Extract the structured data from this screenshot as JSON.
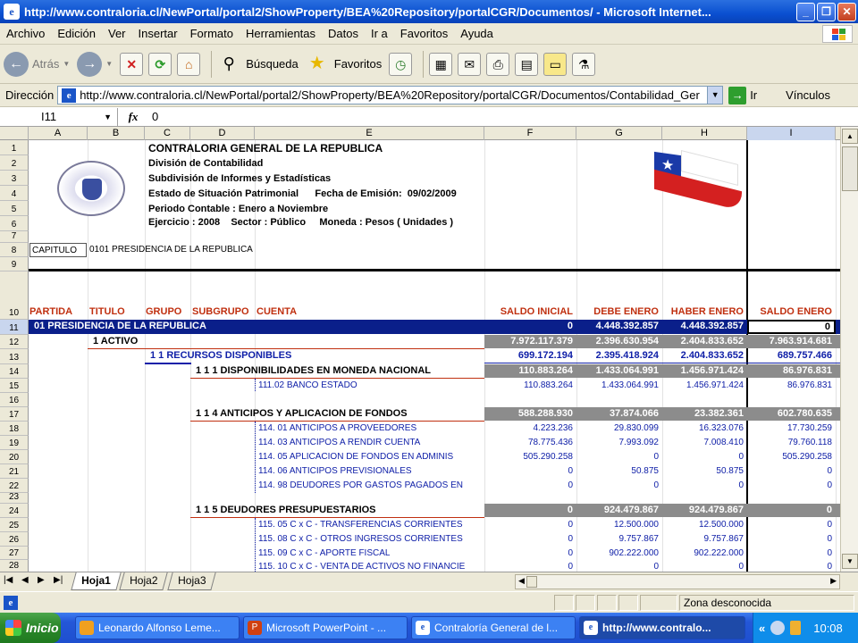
{
  "window": {
    "title": "http://www.contraloria.cl/NewPortal/portal2/ShowProperty/BEA%20Repository/portalCGR/Documentos/ - Microsoft Internet..."
  },
  "menu": [
    "Archivo",
    "Edición",
    "Ver",
    "Insertar",
    "Formato",
    "Herramientas",
    "Datos",
    "Ir a",
    "Favoritos",
    "Ayuda"
  ],
  "toolbar": {
    "back": "Atrás",
    "search": "Búsqueda",
    "favorites": "Favoritos"
  },
  "address": {
    "label": "Dirección",
    "url": "http://www.contraloria.cl/NewPortal/portal2/ShowProperty/BEA%20Repository/portalCGR/Documentos/Contabilidad_Ger",
    "go": "Ir",
    "links": "Vínculos"
  },
  "formula": {
    "cell": "I11",
    "fx": "fx",
    "value": "0"
  },
  "columns": [
    "A",
    "B",
    "C",
    "D",
    "E",
    "F",
    "G",
    "H",
    "I"
  ],
  "rows": [
    "1",
    "2",
    "3",
    "4",
    "5",
    "6",
    "7",
    "8",
    "9",
    "10",
    "11",
    "12",
    "13",
    "14",
    "15",
    "16",
    "17",
    "18",
    "19",
    "20",
    "21",
    "22",
    "23",
    "24",
    "25",
    "26",
    "27",
    "28"
  ],
  "header": {
    "line1": "CONTRALORIA GENERAL DE LA REPUBLICA",
    "line2": "División de Contabilidad",
    "line3": "Subdivisión de Informes y Estadísticas",
    "line4": "Estado de Situación Patrimonial      Fecha de Emisión:  09/02/2009",
    "line5": "Periodo Contable : Enero a Noviembre",
    "line6": "Ejercicio : 2008    Sector : Público     Moneda : Pesos ( Unidades )"
  },
  "capitulo": {
    "label": "CAPITULO",
    "value": "0101 PRESIDENCIA DE LA REPUBLICA"
  },
  "col_headers": {
    "partida": "PARTIDA",
    "titulo": "TITULO",
    "grupo": "GRUPO",
    "subgrupo": "SUBGRUPO",
    "cuenta": "CUENTA",
    "saldo_inicial": "SALDO INICIAL",
    "debe": "DEBE ENERO",
    "haber": "HABER ENERO",
    "saldo": "SALDO ENERO"
  },
  "table": {
    "r11": {
      "label": "01 PRESIDENCIA DE LA REPUBLICA",
      "f": "0",
      "g": "4.448.392.857",
      "h": "4.448.392.857",
      "i": "0"
    },
    "r12": {
      "label": "1 ACTIVO",
      "f": "7.972.117.379",
      "g": "2.396.630.954",
      "h": "2.404.833.652",
      "i": "7.963.914.681"
    },
    "r13": {
      "label": "1 1 RECURSOS DISPONIBLES",
      "f": "699.172.194",
      "g": "2.395.418.924",
      "h": "2.404.833.652",
      "i": "689.757.466"
    },
    "r14": {
      "label": "1 1 1 DISPONIBILIDADES EN MONEDA NACIONAL",
      "f": "110.883.264",
      "g": "1.433.064.991",
      "h": "1.456.971.424",
      "i": "86.976.831"
    },
    "r15": {
      "label": "111.02 BANCO ESTADO",
      "f": "110.883.264",
      "g": "1.433.064.991",
      "h": "1.456.971.424",
      "i": "86.976.831"
    },
    "r17": {
      "label": "1 1 4 ANTICIPOS Y APLICACION DE FONDOS",
      "f": "588.288.930",
      "g": "37.874.066",
      "h": "23.382.361",
      "i": "602.780.635"
    },
    "r18": {
      "label": "114. 01 ANTICIPOS A PROVEEDORES",
      "f": "4.223.236",
      "g": "29.830.099",
      "h": "16.323.076",
      "i": "17.730.259"
    },
    "r19": {
      "label": "114. 03 ANTICIPOS A RENDIR CUENTA",
      "f": "78.775.436",
      "g": "7.993.092",
      "h": "7.008.410",
      "i": "79.760.118"
    },
    "r20": {
      "label": "114. 05 APLICACION DE FONDOS EN ADMINIS",
      "f": "505.290.258",
      "g": "0",
      "h": "0",
      "i": "505.290.258"
    },
    "r21": {
      "label": "114. 06 ANTICIPOS PREVISIONALES",
      "f": "0",
      "g": "50.875",
      "h": "50.875",
      "i": "0"
    },
    "r22": {
      "label": "114. 98 DEUDORES POR GASTOS PAGADOS EN",
      "f": "0",
      "g": "0",
      "h": "0",
      "i": "0"
    },
    "r24": {
      "label": "1 1 5 DEUDORES PRESUPUESTARIOS",
      "f": "0",
      "g": "924.479.867",
      "h": "924.479.867",
      "i": "0"
    },
    "r25": {
      "label": "115. 05 C x C - TRANSFERENCIAS CORRIENTES",
      "f": "0",
      "g": "12.500.000",
      "h": "12.500.000",
      "i": "0"
    },
    "r26": {
      "label": "115. 08 C x C - OTROS INGRESOS CORRIENTES",
      "f": "0",
      "g": "9.757.867",
      "h": "9.757.867",
      "i": "0"
    },
    "r27": {
      "label": "115. 09 C x C - APORTE FISCAL",
      "f": "0",
      "g": "902.222.000",
      "h": "902.222.000",
      "i": "0"
    },
    "r28": {
      "label": "115. 10 C x C - VENTA DE ACTIVOS NO FINANCIE",
      "f": "0",
      "g": "0",
      "h": "0",
      "i": "0"
    }
  },
  "sheets": [
    "Hoja1",
    "Hoja2",
    "Hoja3"
  ],
  "status": {
    "zone": "Zona desconocida"
  },
  "taskbar": {
    "start": "Inicio",
    "tasks": [
      "Leonardo Alfonso Leme...",
      "Microsoft PowerPoint - ...",
      "Contraloría General de l...",
      "http://www.contralo..."
    ],
    "chevron": "«",
    "clock": "10:08"
  },
  "colors": {
    "navy": "#0a1f8a",
    "bar_gray": "#8c8c8c",
    "blue_text": "#1020a8",
    "red_header": "#c03010"
  }
}
